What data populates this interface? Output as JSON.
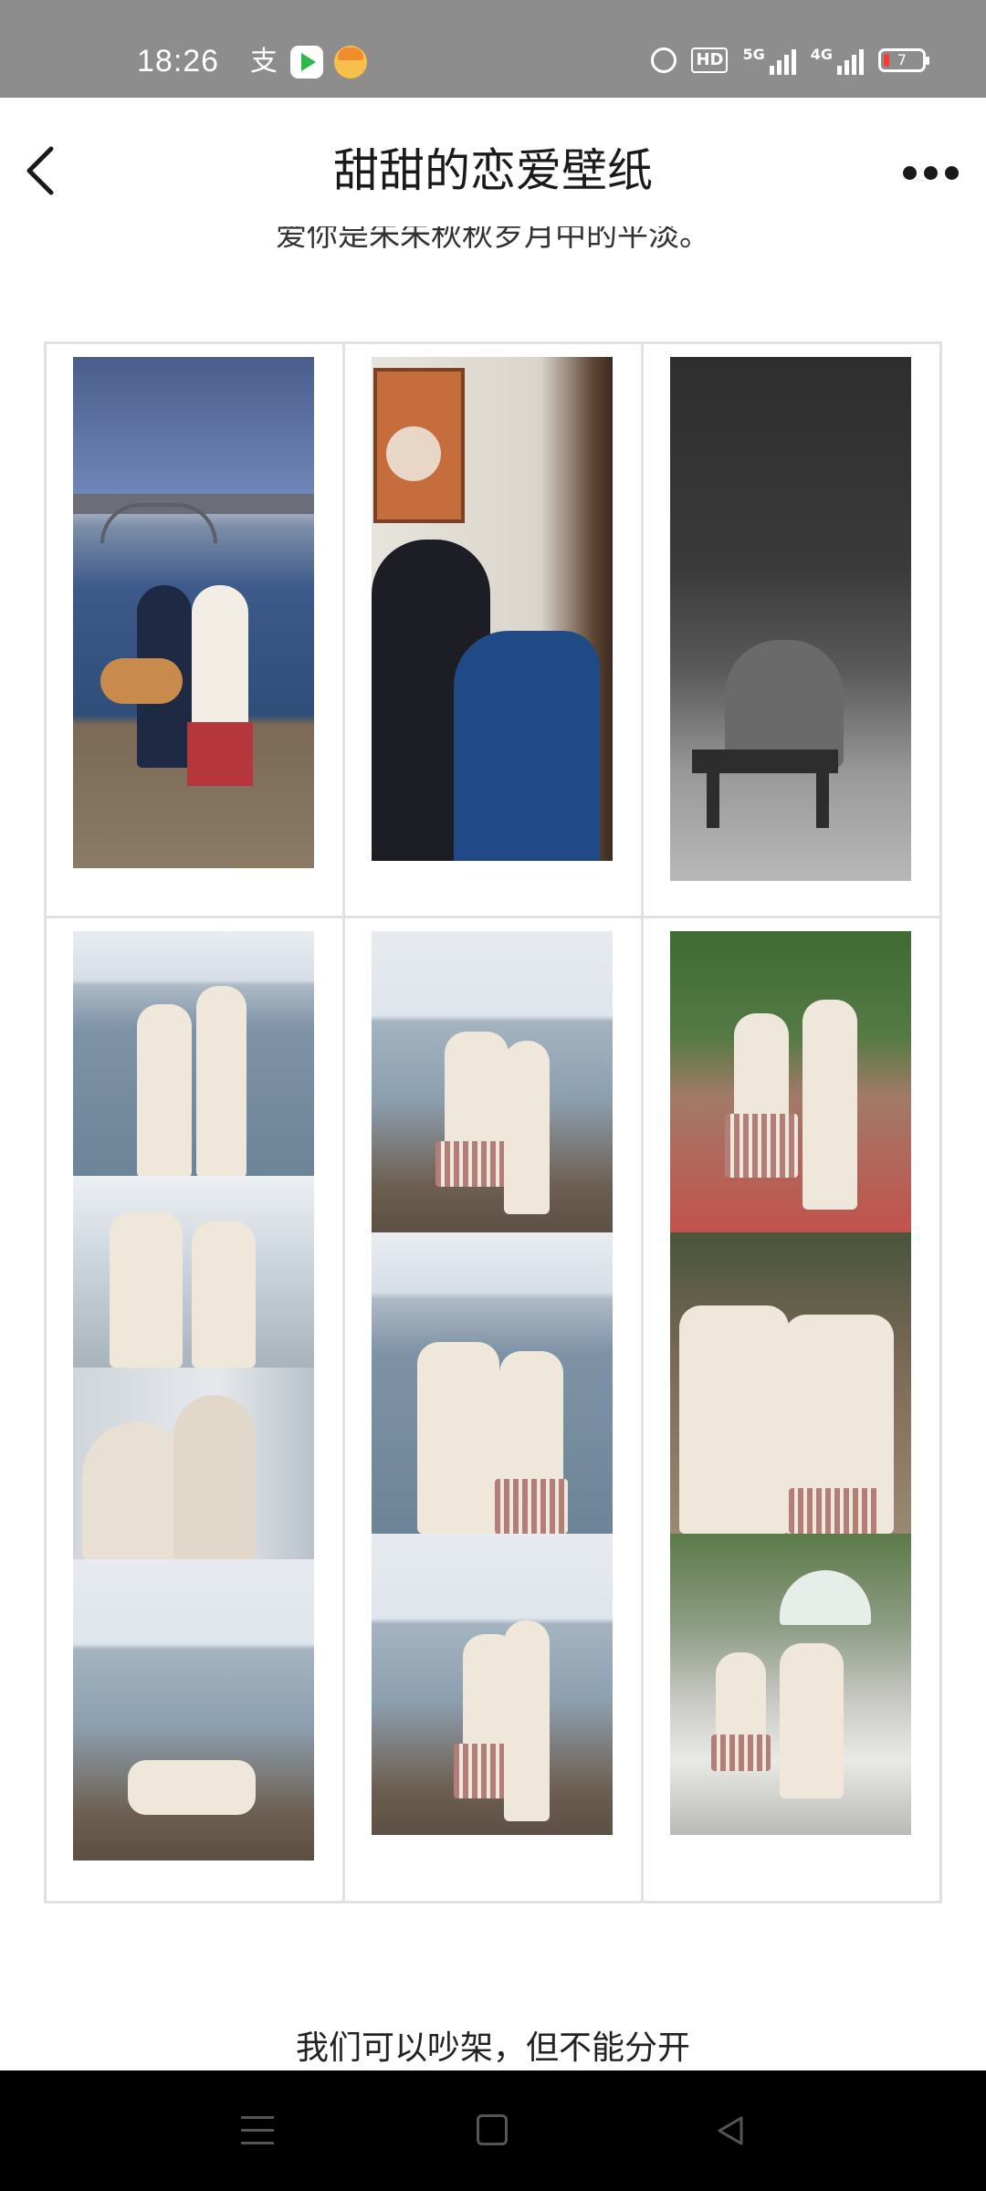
{
  "status_bar": {
    "time": "18:26",
    "network_5g_label": "5G",
    "network_4g_label": "4G",
    "hd_label": "HD",
    "battery_level": "7",
    "icons": [
      "alipay-icon",
      "video-app-icon",
      "game-app-icon",
      "alarm-icon",
      "hd-icon",
      "signal-5g-icon",
      "signal-4g-icon",
      "battery-icon"
    ]
  },
  "header": {
    "title": "甜甜的恋爱壁纸",
    "back_icon": "chevron-left-icon",
    "more_icon": "more-horizontal-icon"
  },
  "content": {
    "top_text": "爱你是朱朱秋秋岁月中的平淡。",
    "bottom_caption": "我们可以吵架，但不能分开",
    "photo_grid": {
      "rows": [
        {
          "cells": [
            "couple-river-dogs-photo",
            "couple-room-vintage-photo",
            "couple-bench-bw-photo"
          ]
        },
        {
          "cells": [
            "couple-riverside-collage-photo",
            "couple-lakeside-pose-collage-photo",
            "couple-street-collage-photo"
          ]
        }
      ]
    }
  },
  "nav_bar": {
    "icons": [
      "menu-icon",
      "home-icon",
      "back-triangle-icon"
    ]
  }
}
